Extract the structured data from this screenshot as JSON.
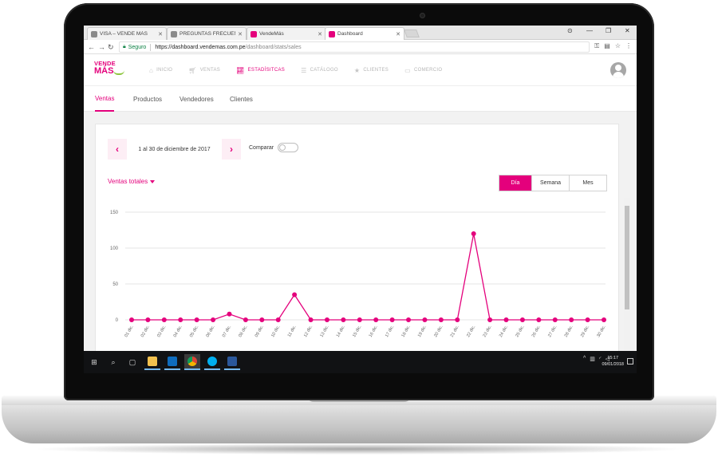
{
  "browser": {
    "tabs": [
      {
        "label": "VISA – VENDE MÁS",
        "favicon": "document-icon"
      },
      {
        "label": "PREGUNTAS FRECUENTE",
        "favicon": "document-icon"
      },
      {
        "label": "VendeMás",
        "favicon": "vendemas-icon"
      },
      {
        "label": "Dashboard",
        "favicon": "vendemas-icon"
      }
    ],
    "active_tab_index": 3,
    "secure_label": "Seguro",
    "url_host": "https://dashboard.vendemas.com.pe",
    "url_path": "/dashboard/stats/sales"
  },
  "app": {
    "logo_top": "VENDE",
    "logo_bottom": "MÁS",
    "nav": [
      {
        "label": "INICIO",
        "icon": "home-icon"
      },
      {
        "label": "VENTAS",
        "icon": "cart-icon"
      },
      {
        "label": "ESTADÍSITCAS",
        "icon": "chart-icon",
        "active": true
      },
      {
        "label": "CATÁLOGO",
        "icon": "list-icon"
      },
      {
        "label": "CLIENTES",
        "icon": "star-icon"
      },
      {
        "label": "COMERCIO",
        "icon": "shop-icon"
      }
    ],
    "subtabs": [
      "Ventas",
      "Productos",
      "Vendedores",
      "Clientes"
    ],
    "active_subtab": "Ventas"
  },
  "controls": {
    "date_range": "1 al 30 de diciembre de 2017",
    "compare_label": "Comparar",
    "metric_label": "Ventas totales",
    "periods": [
      "Día",
      "Semana",
      "Mes"
    ],
    "active_period": "Día"
  },
  "colors": {
    "accent": "#e4007c",
    "logo_green": "#8dc63f"
  },
  "chart_data": {
    "type": "line",
    "ylim": [
      0,
      150
    ],
    "yticks": [
      0,
      50,
      100,
      150
    ],
    "categories": [
      "01 dic.",
      "02 dic.",
      "03 dic.",
      "04 dic.",
      "05 dic.",
      "06 dic.",
      "07 dic.",
      "08 dic.",
      "09 dic.",
      "10 dic.",
      "11 dic.",
      "12 dic.",
      "13 dic.",
      "14 dic.",
      "15 dic.",
      "16 dic.",
      "17 dic.",
      "18 dic.",
      "19 dic.",
      "20 dic.",
      "21 dic.",
      "22 dic.",
      "23 dic.",
      "24 dic.",
      "25 dic.",
      "26 dic.",
      "27 dic.",
      "28 dic.",
      "29 dic.",
      "30 dic."
    ],
    "values": [
      0,
      0,
      0,
      0,
      0,
      0,
      8,
      0,
      0,
      0,
      35,
      0,
      0,
      0,
      0,
      0,
      0,
      0,
      0,
      0,
      0,
      120,
      0,
      0,
      0,
      0,
      0,
      0,
      0,
      0
    ],
    "grid": true
  },
  "taskbar": {
    "time": "15:17",
    "date": "09/01/2018"
  }
}
